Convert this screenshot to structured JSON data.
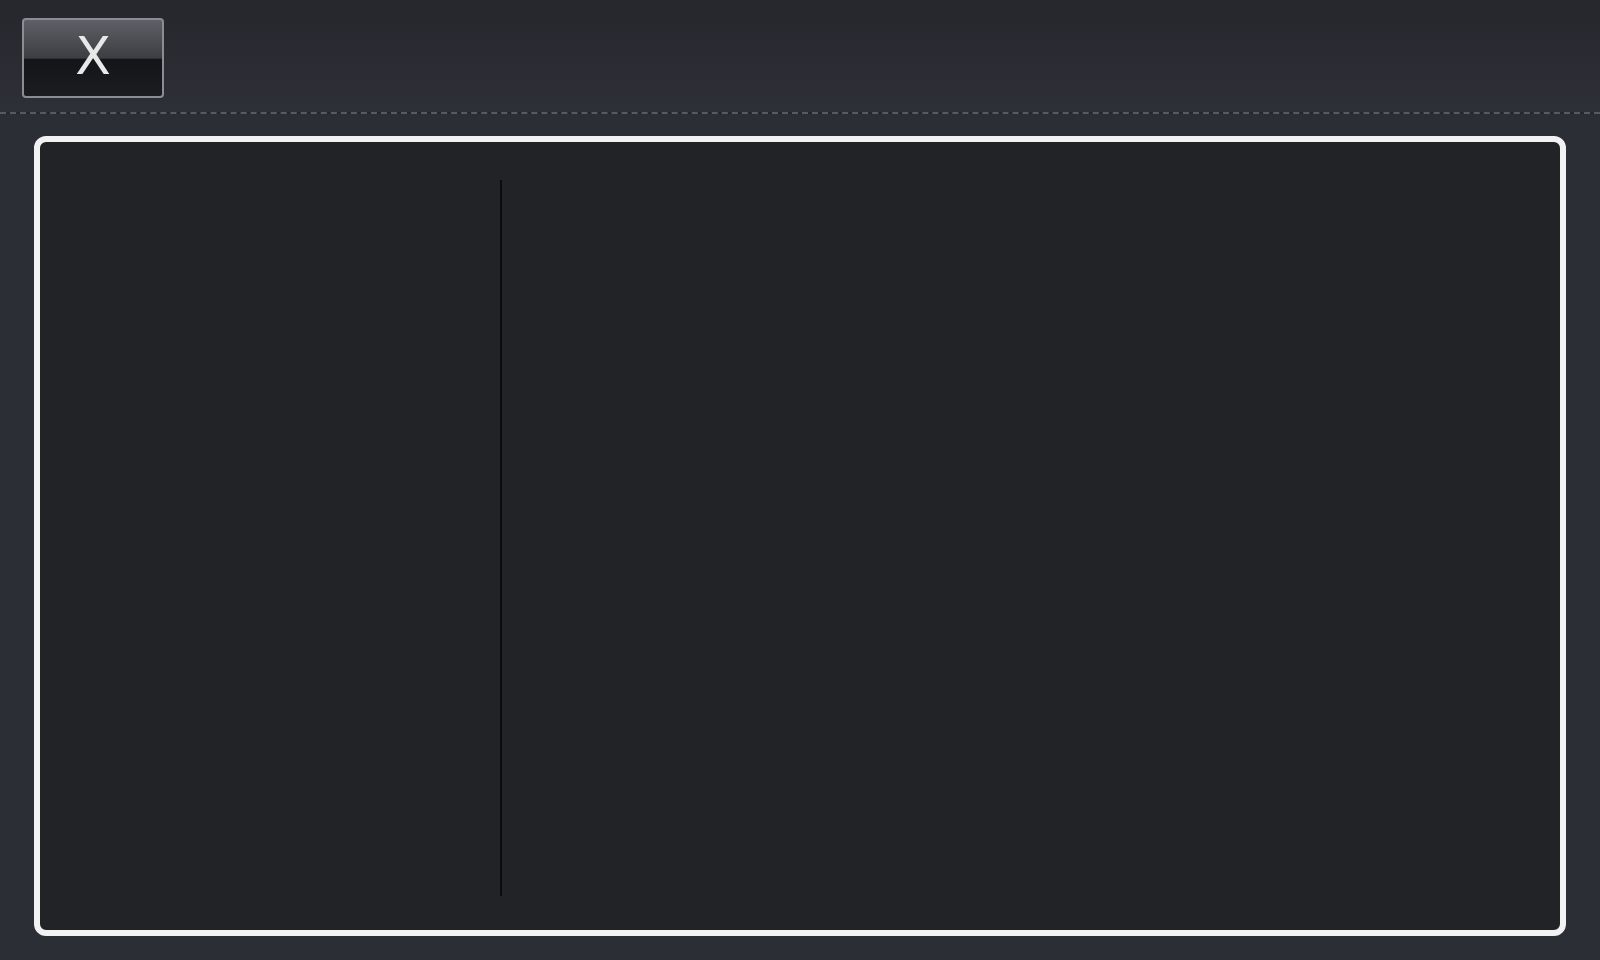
{
  "close_button": {
    "label": "X"
  }
}
